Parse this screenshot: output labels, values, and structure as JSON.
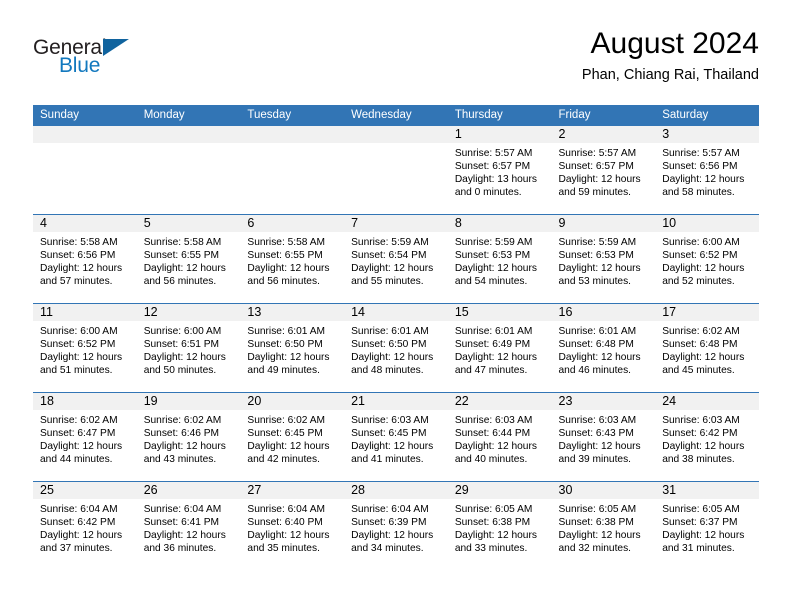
{
  "logo": {
    "word1": "General",
    "word2": "Blue",
    "icon": "triangle-flag-icon",
    "blue": "#1278be",
    "dark_blue": "#10639e"
  },
  "header": {
    "title": "August 2024",
    "location": "Phan, Chiang Rai, Thailand"
  },
  "theme": {
    "header_blue": "#3275b5",
    "daynum_band": "#f1f1f1",
    "text": "#000000"
  },
  "calendar": {
    "weekday_headers": [
      "Sunday",
      "Monday",
      "Tuesday",
      "Wednesday",
      "Thursday",
      "Friday",
      "Saturday"
    ],
    "weeks": [
      [
        {
          "day": "",
          "lines": []
        },
        {
          "day": "",
          "lines": []
        },
        {
          "day": "",
          "lines": []
        },
        {
          "day": "",
          "lines": []
        },
        {
          "day": "1",
          "lines": [
            "Sunrise: 5:57 AM",
            "Sunset: 6:57 PM",
            "Daylight: 13 hours",
            "and 0 minutes."
          ]
        },
        {
          "day": "2",
          "lines": [
            "Sunrise: 5:57 AM",
            "Sunset: 6:57 PM",
            "Daylight: 12 hours",
            "and 59 minutes."
          ]
        },
        {
          "day": "3",
          "lines": [
            "Sunrise: 5:57 AM",
            "Sunset: 6:56 PM",
            "Daylight: 12 hours",
            "and 58 minutes."
          ]
        }
      ],
      [
        {
          "day": "4",
          "lines": [
            "Sunrise: 5:58 AM",
            "Sunset: 6:56 PM",
            "Daylight: 12 hours",
            "and 57 minutes."
          ]
        },
        {
          "day": "5",
          "lines": [
            "Sunrise: 5:58 AM",
            "Sunset: 6:55 PM",
            "Daylight: 12 hours",
            "and 56 minutes."
          ]
        },
        {
          "day": "6",
          "lines": [
            "Sunrise: 5:58 AM",
            "Sunset: 6:55 PM",
            "Daylight: 12 hours",
            "and 56 minutes."
          ]
        },
        {
          "day": "7",
          "lines": [
            "Sunrise: 5:59 AM",
            "Sunset: 6:54 PM",
            "Daylight: 12 hours",
            "and 55 minutes."
          ]
        },
        {
          "day": "8",
          "lines": [
            "Sunrise: 5:59 AM",
            "Sunset: 6:53 PM",
            "Daylight: 12 hours",
            "and 54 minutes."
          ]
        },
        {
          "day": "9",
          "lines": [
            "Sunrise: 5:59 AM",
            "Sunset: 6:53 PM",
            "Daylight: 12 hours",
            "and 53 minutes."
          ]
        },
        {
          "day": "10",
          "lines": [
            "Sunrise: 6:00 AM",
            "Sunset: 6:52 PM",
            "Daylight: 12 hours",
            "and 52 minutes."
          ]
        }
      ],
      [
        {
          "day": "11",
          "lines": [
            "Sunrise: 6:00 AM",
            "Sunset: 6:52 PM",
            "Daylight: 12 hours",
            "and 51 minutes."
          ]
        },
        {
          "day": "12",
          "lines": [
            "Sunrise: 6:00 AM",
            "Sunset: 6:51 PM",
            "Daylight: 12 hours",
            "and 50 minutes."
          ]
        },
        {
          "day": "13",
          "lines": [
            "Sunrise: 6:01 AM",
            "Sunset: 6:50 PM",
            "Daylight: 12 hours",
            "and 49 minutes."
          ]
        },
        {
          "day": "14",
          "lines": [
            "Sunrise: 6:01 AM",
            "Sunset: 6:50 PM",
            "Daylight: 12 hours",
            "and 48 minutes."
          ]
        },
        {
          "day": "15",
          "lines": [
            "Sunrise: 6:01 AM",
            "Sunset: 6:49 PM",
            "Daylight: 12 hours",
            "and 47 minutes."
          ]
        },
        {
          "day": "16",
          "lines": [
            "Sunrise: 6:01 AM",
            "Sunset: 6:48 PM",
            "Daylight: 12 hours",
            "and 46 minutes."
          ]
        },
        {
          "day": "17",
          "lines": [
            "Sunrise: 6:02 AM",
            "Sunset: 6:48 PM",
            "Daylight: 12 hours",
            "and 45 minutes."
          ]
        }
      ],
      [
        {
          "day": "18",
          "lines": [
            "Sunrise: 6:02 AM",
            "Sunset: 6:47 PM",
            "Daylight: 12 hours",
            "and 44 minutes."
          ]
        },
        {
          "day": "19",
          "lines": [
            "Sunrise: 6:02 AM",
            "Sunset: 6:46 PM",
            "Daylight: 12 hours",
            "and 43 minutes."
          ]
        },
        {
          "day": "20",
          "lines": [
            "Sunrise: 6:02 AM",
            "Sunset: 6:45 PM",
            "Daylight: 12 hours",
            "and 42 minutes."
          ]
        },
        {
          "day": "21",
          "lines": [
            "Sunrise: 6:03 AM",
            "Sunset: 6:45 PM",
            "Daylight: 12 hours",
            "and 41 minutes."
          ]
        },
        {
          "day": "22",
          "lines": [
            "Sunrise: 6:03 AM",
            "Sunset: 6:44 PM",
            "Daylight: 12 hours",
            "and 40 minutes."
          ]
        },
        {
          "day": "23",
          "lines": [
            "Sunrise: 6:03 AM",
            "Sunset: 6:43 PM",
            "Daylight: 12 hours",
            "and 39 minutes."
          ]
        },
        {
          "day": "24",
          "lines": [
            "Sunrise: 6:03 AM",
            "Sunset: 6:42 PM",
            "Daylight: 12 hours",
            "and 38 minutes."
          ]
        }
      ],
      [
        {
          "day": "25",
          "lines": [
            "Sunrise: 6:04 AM",
            "Sunset: 6:42 PM",
            "Daylight: 12 hours",
            "and 37 minutes."
          ]
        },
        {
          "day": "26",
          "lines": [
            "Sunrise: 6:04 AM",
            "Sunset: 6:41 PM",
            "Daylight: 12 hours",
            "and 36 minutes."
          ]
        },
        {
          "day": "27",
          "lines": [
            "Sunrise: 6:04 AM",
            "Sunset: 6:40 PM",
            "Daylight: 12 hours",
            "and 35 minutes."
          ]
        },
        {
          "day": "28",
          "lines": [
            "Sunrise: 6:04 AM",
            "Sunset: 6:39 PM",
            "Daylight: 12 hours",
            "and 34 minutes."
          ]
        },
        {
          "day": "29",
          "lines": [
            "Sunrise: 6:05 AM",
            "Sunset: 6:38 PM",
            "Daylight: 12 hours",
            "and 33 minutes."
          ]
        },
        {
          "day": "30",
          "lines": [
            "Sunrise: 6:05 AM",
            "Sunset: 6:38 PM",
            "Daylight: 12 hours",
            "and 32 minutes."
          ]
        },
        {
          "day": "31",
          "lines": [
            "Sunrise: 6:05 AM",
            "Sunset: 6:37 PM",
            "Daylight: 12 hours",
            "and 31 minutes."
          ]
        }
      ]
    ]
  }
}
